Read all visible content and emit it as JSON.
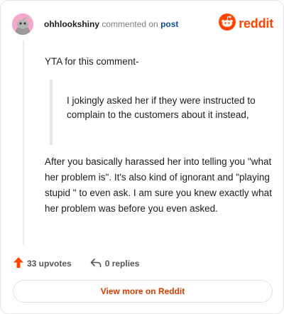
{
  "header": {
    "username": "ohhlookshiny",
    "action_text": "commented on",
    "post_link": "post",
    "logo_text": "reddit"
  },
  "comment": {
    "intro": "YTA for this comment-",
    "quote": "I jokingly asked her if they were instructed to complain to the customers about it instead,",
    "body": "After you basically harassed her into telling you \"what her problem is\". It's also kind of ignorant and \"playing stupid \" to even ask. I am sure you knew exactly what her problem was before you even asked."
  },
  "actions": {
    "upvotes": "33 upvotes",
    "replies": "0 replies"
  },
  "footer": {
    "view_more": "View more on Reddit"
  },
  "colors": {
    "brand": "#ff4500",
    "link": "#0f4c9c",
    "avatar_bg": "#f5a7cc"
  },
  "icons": {
    "avatar": "snoo-avatar-icon",
    "logo": "reddit-logo-icon",
    "upvote": "upvote-arrow-icon",
    "reply": "reply-arrow-icon"
  }
}
